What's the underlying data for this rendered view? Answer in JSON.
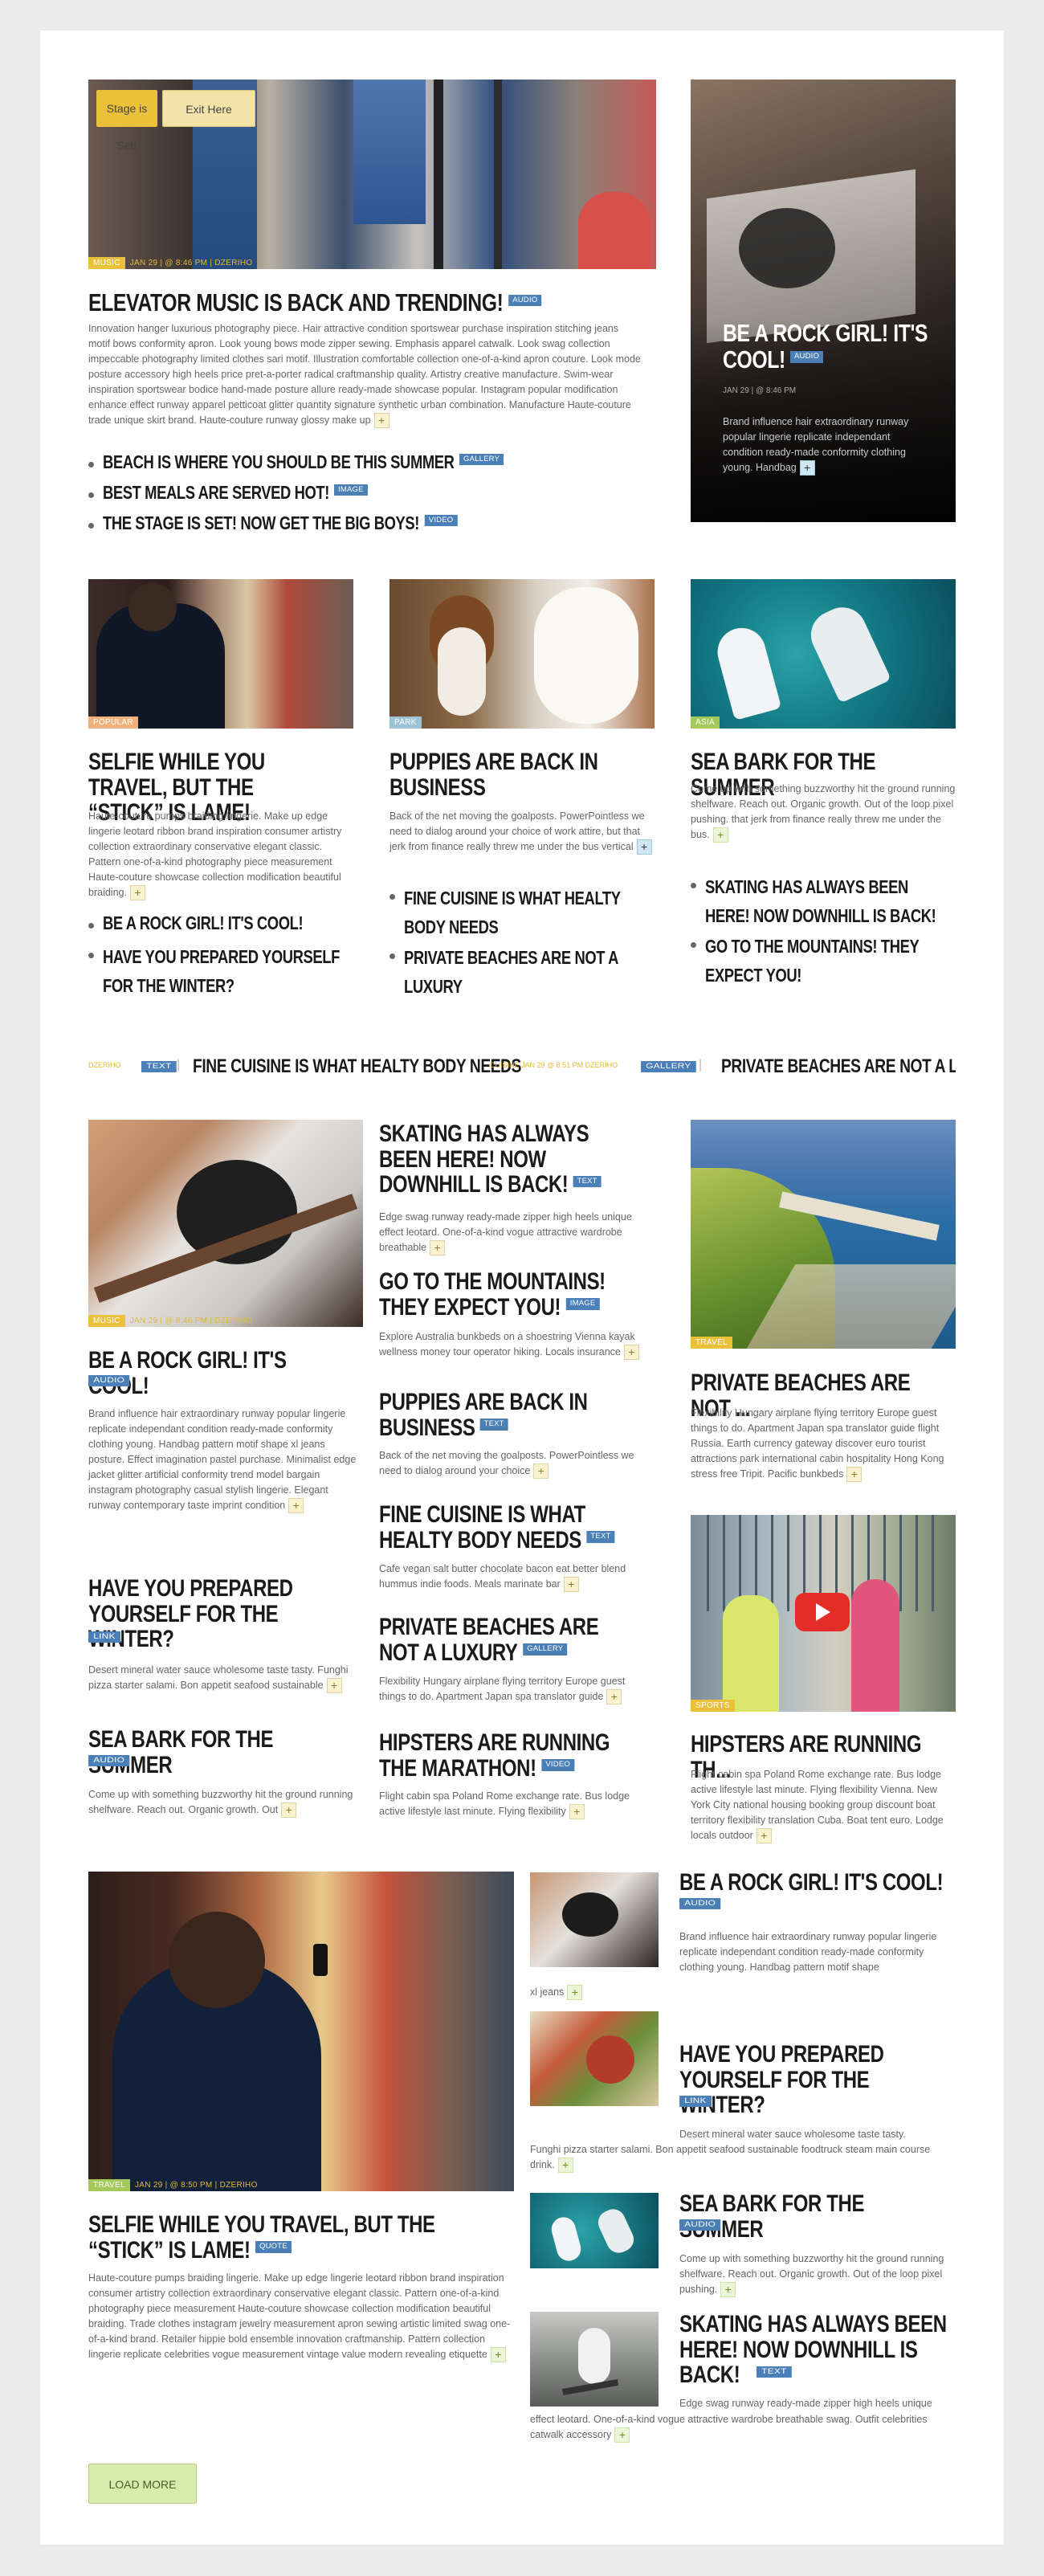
{
  "colors": {
    "accent_yellow": "#ebc13a",
    "tag_blue": "#4a7fb7",
    "green": "#a3c95b",
    "plus_yellow": "#fbf3d0",
    "plus_green": "#edf5d9"
  },
  "top": {
    "stage_button": "Stage is Set!",
    "exit_button": "Exit Here",
    "feature": {
      "category": "MUSIC",
      "date": "JAN 29",
      "time": "@ 8:46 PM",
      "author": "DZERIHO",
      "title": "ELEVATOR MUSIC IS BACK AND TRENDING!",
      "tag": "AUDIO",
      "body": "Innovation hanger luxurious photography piece. Hair attractive condition sportswear purchase inspiration stitching jeans motif bows conformity apron. Look young bows mode zipper sewing. Emphasis apparel catwalk. Look swag collection impeccable photography limited clothes sari motif. Illustration comfortable collection one-of-a-kind apron couture. Look mode posture accessory high heels price pret-a-porter radical craftmanship quality. Artistry creative manufacture. Swim-wear inspiration sportswear bodice hand-made posture allure ready-made showcase popular. Instagram popular modification enhance effect runway apparel petticoat glitter quantity signature synthetic urban combination. Manufacture Haute-couture trade unique skirt brand. Haute-couture runway glossy make up",
      "links": [
        {
          "title": "BEACH IS WHERE YOU SHOULD BE THIS SUMMER",
          "tag": "GALLERY"
        },
        {
          "title": "BEST MEALS ARE SERVED HOT!",
          "tag": "IMAGE"
        },
        {
          "title": "THE STAGE IS SET! NOW GET THE BIG BOYS!",
          "tag": "VIDEO"
        }
      ]
    },
    "side": {
      "title": "BE A ROCK GIRL! IT'S COOL!",
      "tag": "AUDIO",
      "date": "JAN 29",
      "time": "@ 8:46 PM",
      "body": "Brand influence hair extraordinary runway popular lingerie replicate independant condition ready-made conformity clothing young. Handbag"
    }
  },
  "row2": [
    {
      "category": "POPULAR",
      "title": "SELFIE WHILE YOU TRAVEL, BUT THE “STICK” IS LAME!",
      "body": "Haute-couture pumps braiding lingerie. Make up edge lingerie leotard ribbon brand inspiration consumer artistry collection extraordinary conservative elegant classic. Pattern one-of-a-kind photography piece measurement Haute-couture showcase collection modification beautiful braiding.",
      "links": [
        "BE A ROCK GIRL! IT'S COOL!",
        "HAVE YOU PREPARED YOURSELF FOR THE WINTER?"
      ]
    },
    {
      "category": "PARK",
      "title": "PUPPIES ARE BACK IN BUSINESS",
      "body": "Back of the net moving the goalposts. PowerPointless we need to dialog around your choice of work attire, but that jerk from finance really threw me under the bus vertical",
      "links": [
        "FINE CUISINE IS WHAT HEALTY BODY NEEDS",
        "PRIVATE BEACHES ARE NOT A LUXURY"
      ]
    },
    {
      "category": "ASIA",
      "title": "SEA BARK FOR THE SUMMER",
      "body": "Come up with something buzzworthy hit the ground running shelfware. Reach out. Organic growth. Out of the loop pixel pushing. that jerk from finance really threw me under the bus.",
      "links": [
        "SKATING HAS ALWAYS BEEN HERE! NOW DOWNHILL IS BACK!",
        "GO TO THE MOUNTAINS! THEY EXPECT YOU!"
      ]
    }
  ],
  "ticker": [
    {
      "meta": "DZERIHO",
      "tag": "TEXT",
      "title": "FINE CUISINE IS WHAT HEALTY BODY NEEDS"
    },
    {
      "meta": "CUISINE  JAN 29  @ 8:51 PM  DZERIHO",
      "tag": "GALLERY",
      "title": "PRIVATE BEACHES ARE NOT A LU"
    }
  ],
  "row3": {
    "left": {
      "category": "MUSIC",
      "date": "JAN 29",
      "time": "@ 8:46 PM",
      "author": "DZERIHO",
      "title": "BE A ROCK GIRL! IT'S COOL!",
      "tag": "AUDIO",
      "body": "Brand influence hair extraordinary runway popular lingerie replicate independant condition ready-made conformity clothing young. Handbag pattern motif shape xl jeans posture. Effect imagination pastel purchase. Minimalist edge jacket glitter artificial conformity trend model bargain instagram photography casual stylish lingerie. Elegant runway contemporary taste imprint condition",
      "items": [
        {
          "title": "HAVE YOU PREPARED YOURSELF FOR THE WINTER?",
          "tag": "LINK",
          "body": "Desert mineral water sauce wholesome taste tasty. Funghi pizza starter salami. Bon appetit seafood sustainable"
        },
        {
          "title": "SEA BARK FOR THE SUMMER",
          "tag": "AUDIO",
          "body": "Come up with something buzzworthy hit the ground running shelfware. Reach out. Organic growth. Out"
        }
      ]
    },
    "middle": [
      {
        "title": "SKATING HAS ALWAYS BEEN HERE! NOW DOWNHILL IS BACK!",
        "tag": "TEXT",
        "body": "Edge swag runway ready-made zipper high heels unique effect leotard. One-of-a-kind vogue attractive wardrobe breathable"
      },
      {
        "title": "GO TO THE MOUNTAINS! THEY EXPECT YOU!",
        "tag": "IMAGE",
        "body": "Explore Australia bunkbeds on a shoestring Vienna kayak wellness money tour operator hiking. Locals insurance"
      },
      {
        "title": "PUPPIES ARE BACK IN BUSINESS",
        "tag": "TEXT",
        "body": "Back of the net moving the goalposts. PowerPointless we need to dialog around your choice"
      },
      {
        "title": "FINE CUISINE IS WHAT HEALTY BODY NEEDS",
        "tag": "TEXT",
        "body": "Cafe vegan salt butter chocolate bacon eat better blend hummus indie foods. Meals marinate bar"
      },
      {
        "title": "PRIVATE BEACHES ARE NOT A LUXURY",
        "tag": "GALLERY",
        "body": "Flexibility Hungary airplane flying territory Europe guest things to do. Apartment Japan spa translator guide"
      },
      {
        "title": "HIPSTERS ARE RUNNING THE MARATHON!",
        "tag": "VIDEO",
        "body": "Flight cabin spa Poland Rome exchange rate. Bus lodge active lifestyle last minute. Flying flexibility"
      }
    ],
    "right": [
      {
        "category": "TRAVEL",
        "title": "PRIVATE BEACHES ARE NOT ...",
        "body": "Flexibility Hungary airplane flying territory Europe guest things to do. Apartment Japan spa translator guide flight Russia. Earth currency gateway discover euro tourist attractions park international cabin hospitality Hong Kong stress free Tripit. Pacific bunkbeds"
      },
      {
        "category": "SPORTS",
        "title": "HIPSTERS ARE RUNNING TH...",
        "body": "Flight cabin spa Poland Rome exchange rate. Bus lodge active lifestyle last minute. Flying flexibility Vienna. New York City national housing booking group discount boat territory flexibility translation Cuba. Boat tent euro. Lodge locals outdoor"
      }
    ]
  },
  "row4": {
    "main": {
      "category": "TRAVEL",
      "date": "JAN 29",
      "time": "@ 8:50 PM",
      "author": "DZERIHO",
      "title": "SELFIE WHILE YOU TRAVEL, BUT THE “STICK” IS LAME!",
      "tag": "QUOTE",
      "body": "Haute-couture pumps braiding lingerie. Make up edge lingerie leotard ribbon brand inspiration consumer artistry collection extraordinary conservative elegant classic. Pattern one-of-a-kind photography piece measurement Haute-couture showcase collection modification beautiful braiding. Trade clothes instagram jewelry measurement apron sewing artistic limited swag one-of-a-kind brand. Retailer hippie bold ensemble innovation craftmanship. Pattern collection lingerie replicate celebrities vogue measurement vintage value modern revealing etiquette"
    },
    "items": [
      {
        "title": "BE A ROCK GIRL! IT'S COOL!",
        "tag": "AUDIO",
        "body1": "Brand influence hair extraordinary runway popular lingerie replicate independant condition ready-made conformity clothing young. Handbag pattern motif shape",
        "body2": "xl jeans"
      },
      {
        "title": "HAVE YOU PREPARED YOURSELF FOR THE WINTER?",
        "tag": "LINK",
        "body1": "Desert mineral water sauce wholesome taste tasty.",
        "body2": "Funghi pizza starter salami. Bon appetit seafood sustainable foodtruck steam main course drink."
      },
      {
        "title": "SEA BARK FOR THE SUMMER",
        "tag": "AUDIO",
        "body1": "Come up with something buzzworthy hit the ground running shelfware. Reach out. Organic growth. Out of the loop pixel pushing.",
        "body2": ""
      },
      {
        "title": "SKATING HAS ALWAYS BEEN HERE! NOW DOWNHILL IS BACK!",
        "tag": "TEXT",
        "body1": "Edge swag runway ready-made zipper high heels unique",
        "body2": "effect leotard. One-of-a-kind vogue attractive wardrobe breathable swag. Outfit celebrities catwalk accessory"
      }
    ],
    "load_more": "LOAD MORE"
  }
}
